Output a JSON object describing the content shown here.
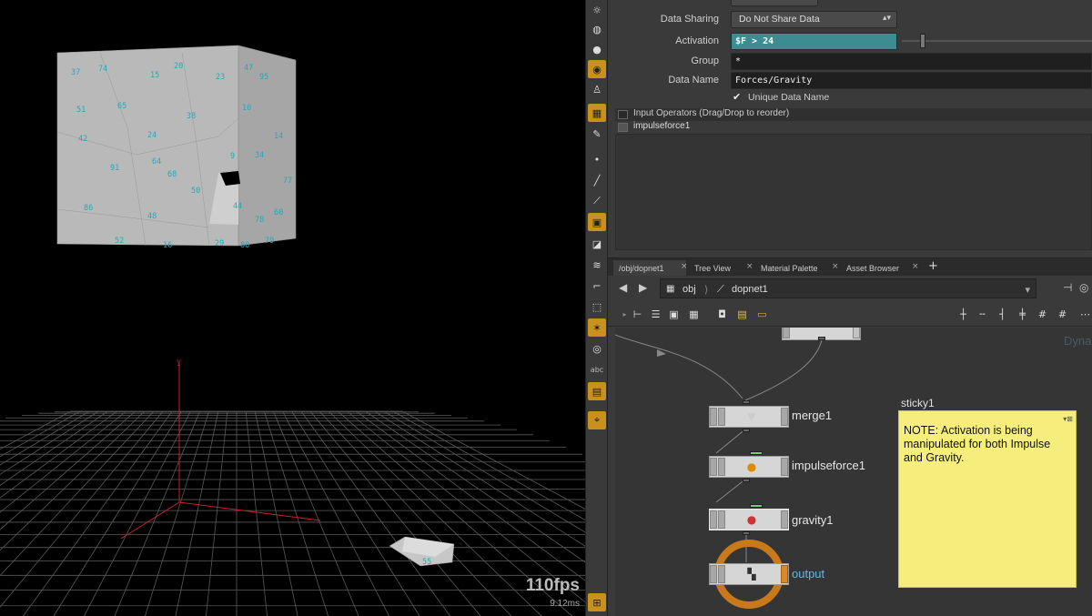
{
  "viewport": {
    "fps": "110fps",
    "frame_time": "9.12ms",
    "axis_label": "y",
    "point_labels": [
      "37",
      "74",
      "15",
      "20",
      "23",
      "47",
      "95",
      "51",
      "65",
      "38",
      "10",
      "42",
      "24",
      "14",
      "91",
      "64",
      "68",
      "9",
      "34",
      "77",
      "50",
      "86",
      "48",
      "44",
      "78",
      "60",
      "52",
      "16",
      "29",
      "80",
      "79",
      "55"
    ]
  },
  "shelf": {
    "tools": [
      "lightbulb-icon",
      "sphere-icon",
      "bulb-icon",
      "pin-icon",
      "person-icon",
      "grid-icon",
      "camera-icon",
      "dot-icon",
      "brush-icon",
      "pen-icon",
      "tag-icon",
      "sponge-icon",
      "wind-icon",
      "angle-icon",
      "select-icon",
      "pointer-icon",
      "circle-icon",
      "abc-label",
      "image-icon",
      "location-icon",
      "panel-icon"
    ],
    "abc_label": "abc"
  },
  "parms": {
    "data_sharing_label": "Data Sharing",
    "data_sharing_value": "Do Not Share Data",
    "activation_label": "Activation",
    "activation_value": "$F > 24",
    "group_label": "Group",
    "group_value": "*",
    "data_name_label": "Data Name",
    "data_name_value": "Forces/Gravity",
    "unique_label": "Unique Data Name",
    "io_header": "Input Operators (Drag/Drop to reorder)",
    "io_item": "impulseforce1"
  },
  "tabs": [
    {
      "label": "/obj/dopnet1"
    },
    {
      "label": "Tree View"
    },
    {
      "label": "Material Palette"
    },
    {
      "label": "Asset Browser"
    }
  ],
  "path": {
    "obj": "obj",
    "dopnet": "dopnet1"
  },
  "network": {
    "nodes": [
      {
        "name": "merge1"
      },
      {
        "name": "impulseforce1"
      },
      {
        "name": "gravity1"
      },
      {
        "name": "output"
      }
    ],
    "faded_label": "Dyna",
    "sticky_title": "sticky1",
    "sticky_text": "NOTE: Activation is being manipulated for both Impulse and Gravity."
  }
}
